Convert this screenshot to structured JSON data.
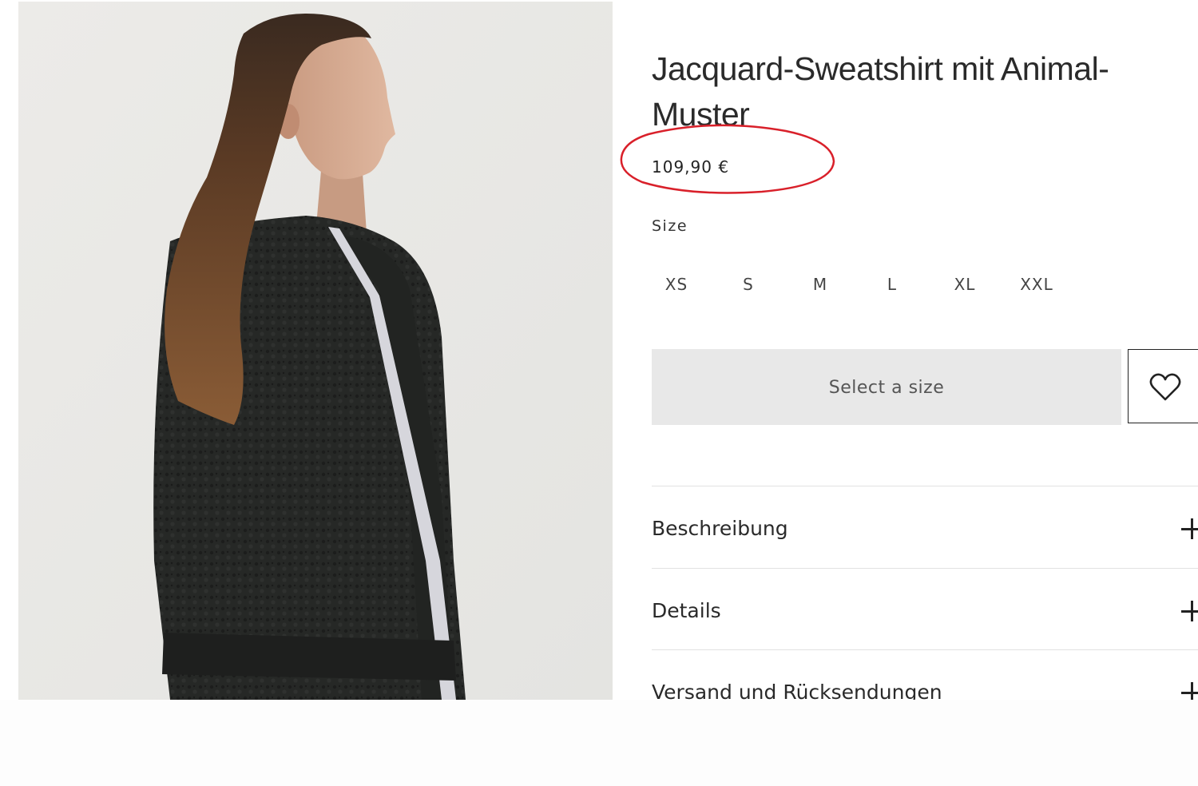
{
  "product": {
    "title": "Jacquard-Sweatshirt mit Animal-Muster",
    "price": "109,90 €"
  },
  "size_selector": {
    "label": "Size",
    "options": [
      "XS",
      "S",
      "M",
      "L",
      "XL",
      "XXL"
    ]
  },
  "actions": {
    "add_button_label": "Select a size",
    "wishlist_icon": "heart-icon"
  },
  "accordion": {
    "items": [
      {
        "label": "Beschreibung",
        "icon": "plus-icon"
      },
      {
        "label": "Details",
        "icon": "plus-icon"
      },
      {
        "label": "Versand und Rücksendungen",
        "icon": "plus-icon"
      }
    ]
  },
  "colors": {
    "annotation_circle": "#d9202a",
    "button_background": "#e8e8e8",
    "photo_background": "#e9e9e7",
    "sweatshirt": "#262826",
    "sleeve_stripe": "#d6d6dc"
  }
}
